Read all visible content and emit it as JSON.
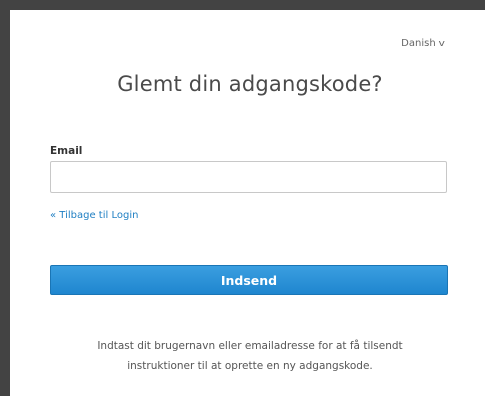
{
  "language": {
    "selected": "Danish",
    "chevron": "v"
  },
  "form": {
    "title": "Glemt din adgangskode?",
    "email_label": "Email",
    "email_value": "",
    "email_placeholder": "",
    "back_link": "« Tilbage til Login",
    "submit_label": "Indsend",
    "help_line_1": "Indtast dit brugernavn eller emailadresse for at få tilsendt",
    "help_line_2": "instruktioner til at oprette en ny adgangskode."
  },
  "colors": {
    "frame": "#434343",
    "accent": "#1f86cf",
    "link": "#1f7fc3"
  }
}
